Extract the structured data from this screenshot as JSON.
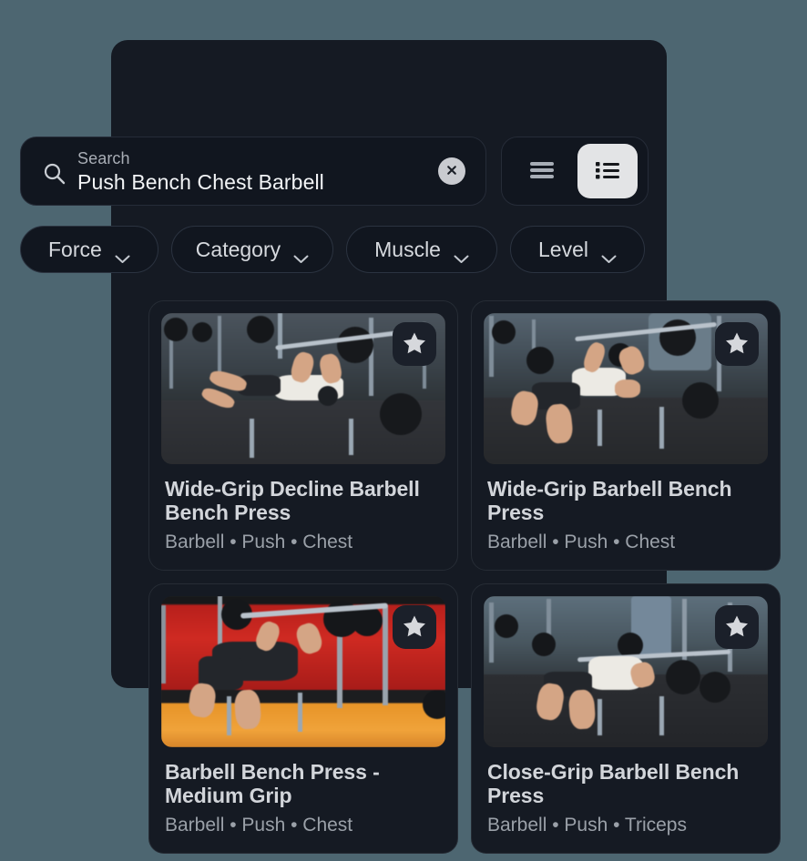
{
  "app": {
    "background_color": "#4d6671",
    "panel_color": "#151a23"
  },
  "search": {
    "label": "Search",
    "value": "Push Bench Chest Barbell",
    "placeholder": "Search",
    "icon": "search-icon",
    "clear_icon": "close-circle-icon",
    "clear_label": "×"
  },
  "view_toggle": {
    "options": [
      {
        "id": "compact-view",
        "icon": "hamburger-list-icon",
        "selected": false
      },
      {
        "id": "detailed-view",
        "icon": "detail-list-icon",
        "selected": true
      }
    ],
    "selected_bg": "#e3e4e6"
  },
  "filters": [
    {
      "label": "Force",
      "icon": "chevron-down-icon"
    },
    {
      "label": "Category",
      "icon": "chevron-down-icon"
    },
    {
      "label": "Muscle",
      "icon": "chevron-down-icon"
    },
    {
      "label": "Level",
      "icon": "chevron-down-icon"
    }
  ],
  "results": [
    {
      "title": "Wide-Grip Decline Barbell Bench Press",
      "meta": "Barbell • Push • Chest",
      "equipment": "Barbell",
      "force": "Push",
      "muscle": "Chest",
      "favorite_icon": "star-icon",
      "favorited": true,
      "scene": "decline-bench-gray-gym"
    },
    {
      "title": "Wide-Grip Barbell Bench Press",
      "meta": "Barbell • Push • Chest",
      "equipment": "Barbell",
      "force": "Push",
      "muscle": "Chest",
      "favorite_icon": "star-icon",
      "favorited": true,
      "scene": "flat-bench-blue-gym"
    },
    {
      "title": "Barbell Bench Press - Medium Grip",
      "meta": "Barbell • Push • Chest",
      "equipment": "Barbell",
      "force": "Push",
      "muscle": "Chest",
      "favorite_icon": "star-icon",
      "favorited": true,
      "scene": "flat-bench-red-wall"
    },
    {
      "title": "Close-Grip Barbell Bench Press",
      "meta": "Barbell • Push • Triceps",
      "equipment": "Barbell",
      "force": "Push",
      "muscle": "Triceps",
      "favorite_icon": "star-icon",
      "favorited": true,
      "scene": "flat-bench-blue-pillar"
    }
  ]
}
